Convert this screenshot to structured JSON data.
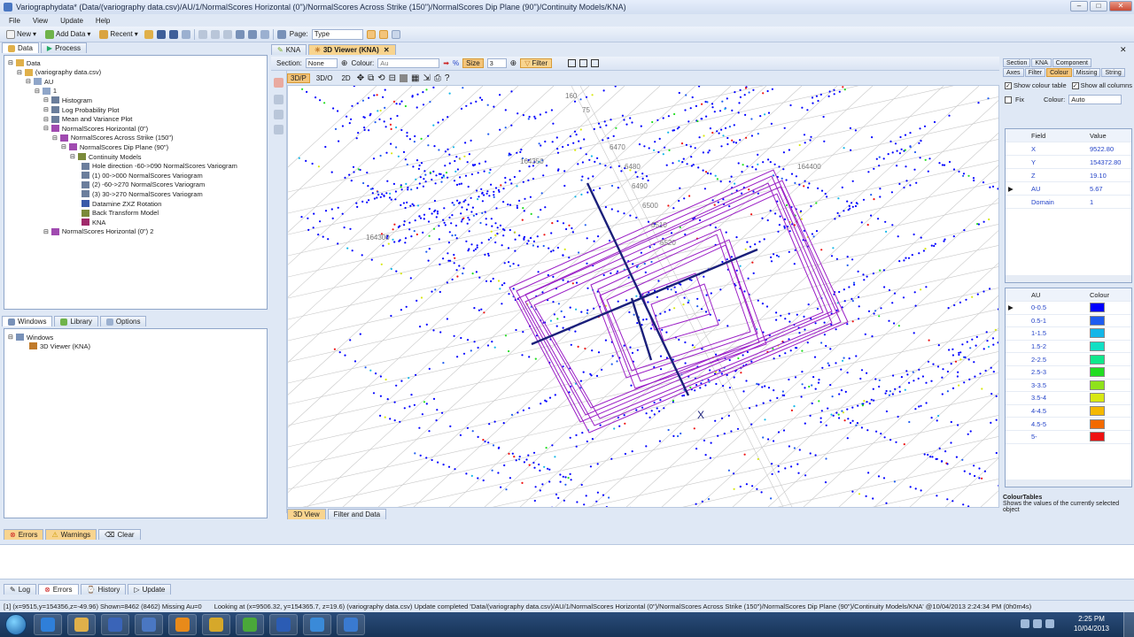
{
  "window": {
    "title": "Variographydata* (Data/(variography data.csv)/AU/1/NormalScores Horizontal (0\")/NormalScores Across Strike (150\")/NormalScores Dip Plane (90\")/Continuity Models/KNA)",
    "min": "–",
    "max": "□",
    "close": "✕"
  },
  "menu": [
    "File",
    "View",
    "Update",
    "Help"
  ],
  "toolbar": {
    "new": "New",
    "add_data": "Add Data",
    "recent": "Recent",
    "page_label": "Page:",
    "page_value": "Type"
  },
  "left": {
    "tabs": [
      "Data",
      "Process"
    ],
    "tree": [
      {
        "label": "Data",
        "depth": 0,
        "icon": "folder-icon"
      },
      {
        "label": "(variography data.csv)",
        "depth": 1,
        "icon": "file-icon"
      },
      {
        "label": "AU",
        "depth": 2,
        "icon": "table-icon"
      },
      {
        "label": "1",
        "depth": 3,
        "icon": "table-icon"
      },
      {
        "label": "Histogram",
        "depth": 4,
        "icon": "chart-icon"
      },
      {
        "label": "Log Probability Plot",
        "depth": 4,
        "icon": "chart-icon"
      },
      {
        "label": "Mean and Variance Plot",
        "depth": 4,
        "icon": "chart-icon"
      },
      {
        "label": "NormalScores Horizontal (0\")",
        "depth": 4,
        "icon": "variogram-icon"
      },
      {
        "label": "NormalScores Across Strike (150\")",
        "depth": 5,
        "icon": "variogram-icon"
      },
      {
        "label": "NormalScores Dip Plane (90\")",
        "depth": 6,
        "icon": "variogram-icon"
      },
      {
        "label": "Continuity Models",
        "depth": 7,
        "icon": "model-icon"
      },
      {
        "label": "Hole direction -60->090 NormalScores Variogram",
        "depth": 8,
        "icon": "chart-icon"
      },
      {
        "label": "(1) 00->000 NormalScores Variogram",
        "depth": 8,
        "icon": "chart-icon"
      },
      {
        "label": "(2) -60->270 NormalScores Variogram",
        "depth": 8,
        "icon": "chart-icon"
      },
      {
        "label": "(3) 30->270 NormalScores Variogram",
        "depth": 8,
        "icon": "chart-icon"
      },
      {
        "label": "Datamine ZXZ Rotation",
        "depth": 8,
        "icon": "rotation-icon"
      },
      {
        "label": "Back Transform Model",
        "depth": 8,
        "icon": "model-icon"
      },
      {
        "label": "KNA",
        "depth": 8,
        "icon": "kna-icon"
      },
      {
        "label": "NormalScores Horizontal (0\") 2",
        "depth": 4,
        "icon": "variogram-icon"
      }
    ],
    "windows_tabs": [
      "Windows",
      "Library",
      "Options"
    ],
    "windows_tree": [
      "Windows",
      "3D Viewer (KNA)"
    ]
  },
  "viewer": {
    "tabs": [
      "KNA",
      "3D Viewer (KNA)"
    ],
    "section_label": "Section:",
    "section_value": "None",
    "colour_label": "Colour:",
    "colour_value": "Au",
    "percent": "%",
    "size_label": "Size",
    "size_value": "3",
    "filter_label": "Filter",
    "modes": [
      "3D/P",
      "3D/O",
      "2D"
    ],
    "bottom_tabs": [
      "3D View",
      "Filter and Data"
    ],
    "scene_labels": [
      "164350",
      "164300",
      "160",
      "75",
      "6470",
      "6480",
      "6490",
      "6500",
      "6510",
      "6520",
      "164400",
      "X"
    ]
  },
  "right": {
    "tabs1": [
      "Section",
      "KNA",
      "Component"
    ],
    "tabs2": [
      "Axes",
      "Filter",
      "Colour",
      "Missing",
      "String"
    ],
    "show_colour_table": "Show colour table",
    "show_all_columns": "Show all columns",
    "fix": "Fix",
    "colour_label": "Colour:",
    "colour_value": "Auto",
    "field_header": "Field",
    "value_header": "Value",
    "fields": [
      {
        "field": "X",
        "value": "9522.80"
      },
      {
        "field": "Y",
        "value": "154372.80"
      },
      {
        "field": "Z",
        "value": "19.10"
      },
      {
        "field": "AU",
        "value": "5.67"
      },
      {
        "field": "Domain",
        "value": "1"
      }
    ],
    "au_header": "AU",
    "colour_header": "Colour",
    "legend": [
      {
        "range": "0-0.5",
        "color": "#0000ff"
      },
      {
        "range": "0.5-1",
        "color": "#1e5cf0"
      },
      {
        "range": "1-1.5",
        "color": "#13b6e8"
      },
      {
        "range": "1.5-2",
        "color": "#12e0c4"
      },
      {
        "range": "2-2.5",
        "color": "#10e88c"
      },
      {
        "range": "2.5-3",
        "color": "#22dd22"
      },
      {
        "range": "3-3.5",
        "color": "#8fe21a"
      },
      {
        "range": "3.5-4",
        "color": "#d8e812"
      },
      {
        "range": "4-4.5",
        "color": "#f5b800"
      },
      {
        "range": "4.5-5",
        "color": "#f36a00"
      },
      {
        "range": "5-",
        "color": "#ee1111"
      }
    ],
    "help_title": "ColourTables",
    "help_text": "Shows the values of the currently selected object"
  },
  "bottom": {
    "tabs": [
      "Errors",
      "Warnings",
      "Clear"
    ],
    "tabs2": [
      "Log",
      "Errors",
      "History",
      "Update"
    ]
  },
  "status": {
    "item1": "[1]  (x=9515,y=154356,z=-49.96)  Shown=8462 (8462)  Missing Au=0",
    "item2": "Looking at (x=9506.32, y=154365.7, z=19.6)   (variography data.csv)   Update completed 'Data/(variography data.csv)/AU/1/NormalScores Horizontal (0\")/NormalScores Across Strike (150\")/NormalScores Dip Plane (90\")/Continuity Models/KNA' @10/04/2013 2:24:34 PM (0h0m4s)"
  },
  "taskbar": {
    "time": "2:25 PM",
    "date": "10/04/2013",
    "apps": [
      "ie-icon",
      "explorer-icon",
      "media-icon",
      "network-icon",
      "outlook-icon",
      "chrome-icon",
      "game-icon",
      "word-icon",
      "globe-icon",
      "snowflake-icon"
    ]
  }
}
